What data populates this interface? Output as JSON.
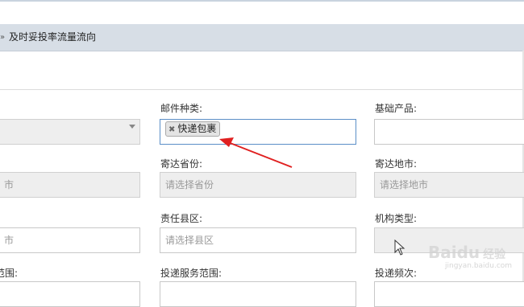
{
  "breadcrumb": {
    "chevron": "»",
    "text": "及时妥投率流量流向"
  },
  "form": {
    "mail_type": {
      "label": "邮件种类:",
      "tag": "快递包裹",
      "tag_remove": "✖"
    },
    "base_product": {
      "label": "基础产品:",
      "value": ""
    },
    "left_row1": {
      "value": ""
    },
    "dest_province": {
      "label": "寄达省份:",
      "placeholder": "请选择省份"
    },
    "dest_city": {
      "label": "寄达地市:",
      "placeholder": "请选择地市"
    },
    "left_row2": {
      "placeholder_fragment": "市"
    },
    "county": {
      "label": "责任县区:",
      "placeholder": "请选择县区"
    },
    "org_type": {
      "label": "机构类型:",
      "value": ""
    },
    "left_row3": {
      "placeholder_fragment": "市"
    },
    "left_row4_label": "范围:",
    "delivery_scope": {
      "label": "投递服务范围:"
    },
    "delivery_freq": {
      "label": "投递频次:"
    }
  },
  "annotation": {
    "arrow_color": "#e02020"
  },
  "watermark": {
    "text": "Baidu",
    "sub": "经验",
    "url": "jingyan.baidu.com"
  }
}
